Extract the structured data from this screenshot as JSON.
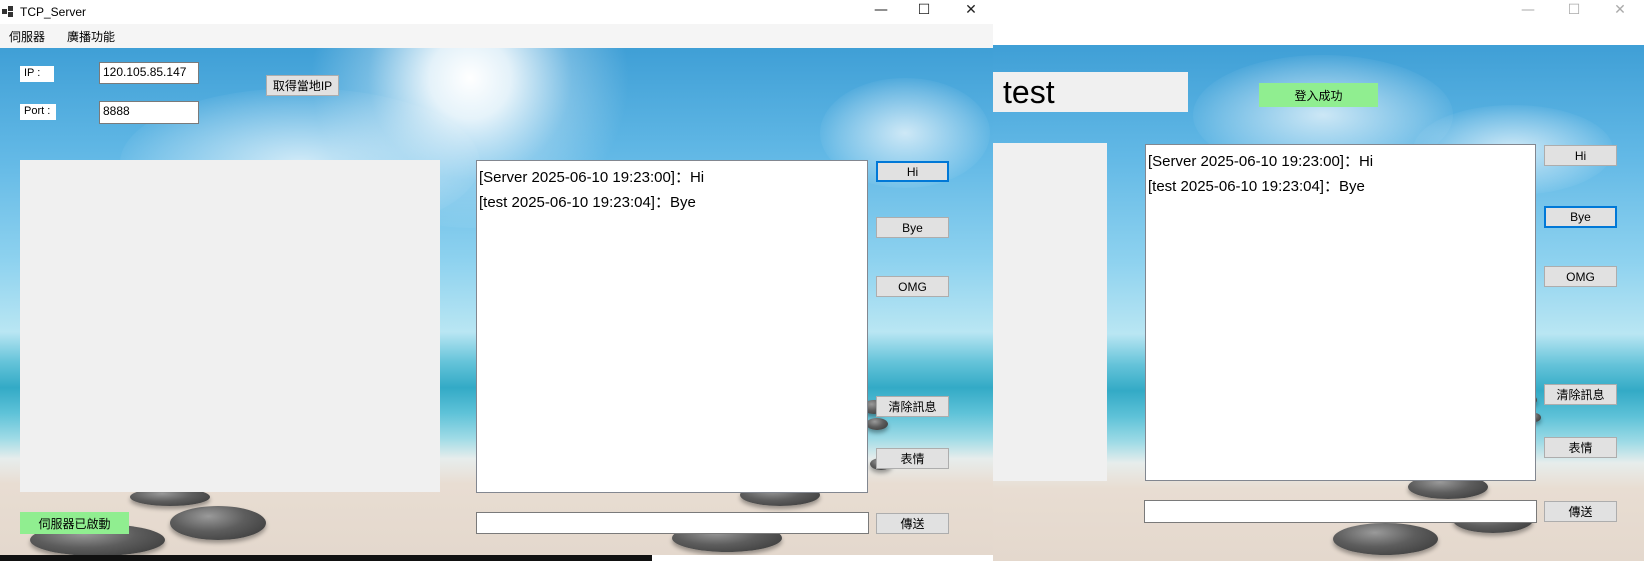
{
  "colors": {
    "status_green": "#90ee90",
    "focus_blue": "#0078d7",
    "panel_gray": "#f0f0f0"
  },
  "server": {
    "title": "TCP_Server",
    "icon": "app-window-icon",
    "menu": [
      "伺服器",
      "廣播功能"
    ],
    "ip_label": "IP :",
    "ip_value": "120.105.85.147",
    "port_label": "Port :",
    "port_value": "8888",
    "get_ip_button": "取得當地IP",
    "messages": [
      "[Server 2025-06-10 19:23:00]：Hi",
      "[test 2025-06-10 19:23:04]：Bye"
    ],
    "buttons": {
      "hi": "Hi",
      "bye": "Bye",
      "omg": "OMG",
      "clear": "清除訊息",
      "emoji": "表情",
      "send": "傳送"
    },
    "status": "伺服器已啟動",
    "input_value": ""
  },
  "client": {
    "username": "test",
    "login_status": "登入成功",
    "messages": [
      "[Server 2025-06-10 19:23:00]：Hi",
      "[test 2025-06-10 19:23:04]：Bye"
    ],
    "buttons": {
      "hi": "Hi",
      "bye": "Bye",
      "omg": "OMG",
      "clear": "清除訊息",
      "emoji": "表情",
      "send": "傳送"
    },
    "input_value": ""
  },
  "window_controls": {
    "minimize": "—",
    "maximize": "☐",
    "close": "✕"
  }
}
